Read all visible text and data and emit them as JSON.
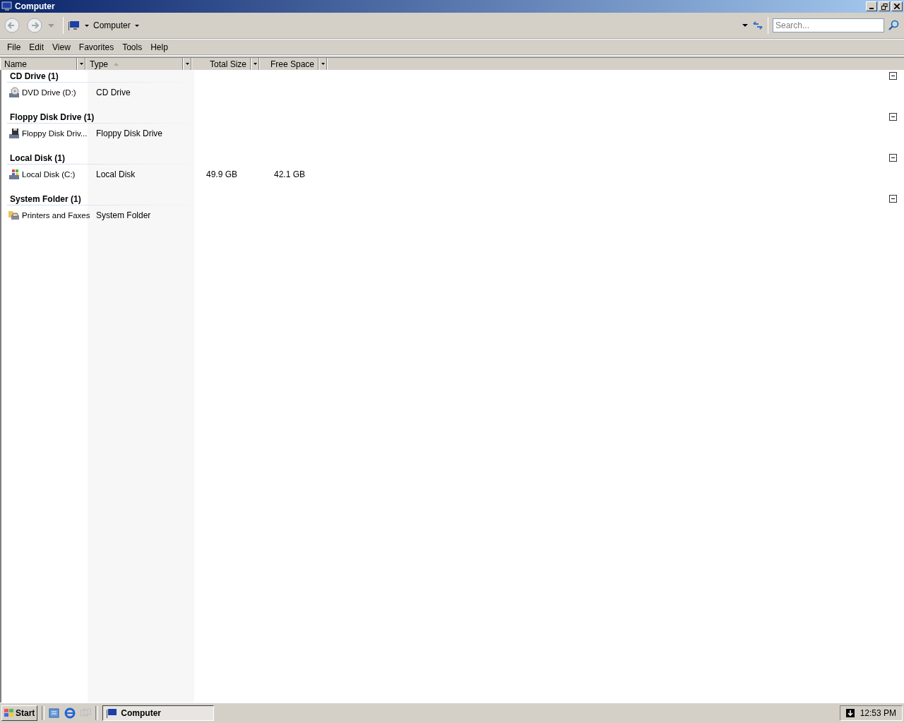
{
  "window": {
    "title": "Computer"
  },
  "address": {
    "location": "Computer"
  },
  "search": {
    "placeholder": "Search..."
  },
  "menu": [
    "File",
    "Edit",
    "View",
    "Favorites",
    "Tools",
    "Help"
  ],
  "columns": [
    {
      "label": "Name",
      "sorted": false
    },
    {
      "label": "Type",
      "sorted": true
    },
    {
      "label": "Total Size",
      "sorted": false
    },
    {
      "label": "Free Space",
      "sorted": false
    }
  ],
  "groups": [
    {
      "title": "CD Drive (1)",
      "expanded": true,
      "items": [
        {
          "kind": "dvd",
          "name": "DVD Drive (D:)",
          "type": "CD Drive"
        }
      ]
    },
    {
      "title": "Floppy Disk Drive (1)",
      "expanded": true,
      "items": [
        {
          "kind": "floppy",
          "name": "Floppy Disk Driv...",
          "type": "Floppy Disk Drive"
        }
      ]
    },
    {
      "title": "Local Disk (1)",
      "expanded": true,
      "items": [
        {
          "kind": "disk",
          "name": "Local Disk (C:)",
          "type": "Local Disk",
          "total_size": "49.9 GB",
          "free_space": "42.1 GB"
        }
      ]
    },
    {
      "title": "System Folder (1)",
      "expanded": true,
      "items": [
        {
          "kind": "printer",
          "name": "Printers and Faxes",
          "type": "System Folder"
        }
      ]
    }
  ],
  "taskbar": {
    "start": "Start",
    "tasks": [
      {
        "label": "Computer",
        "selected": true
      }
    ],
    "clock": "12:53 PM"
  }
}
